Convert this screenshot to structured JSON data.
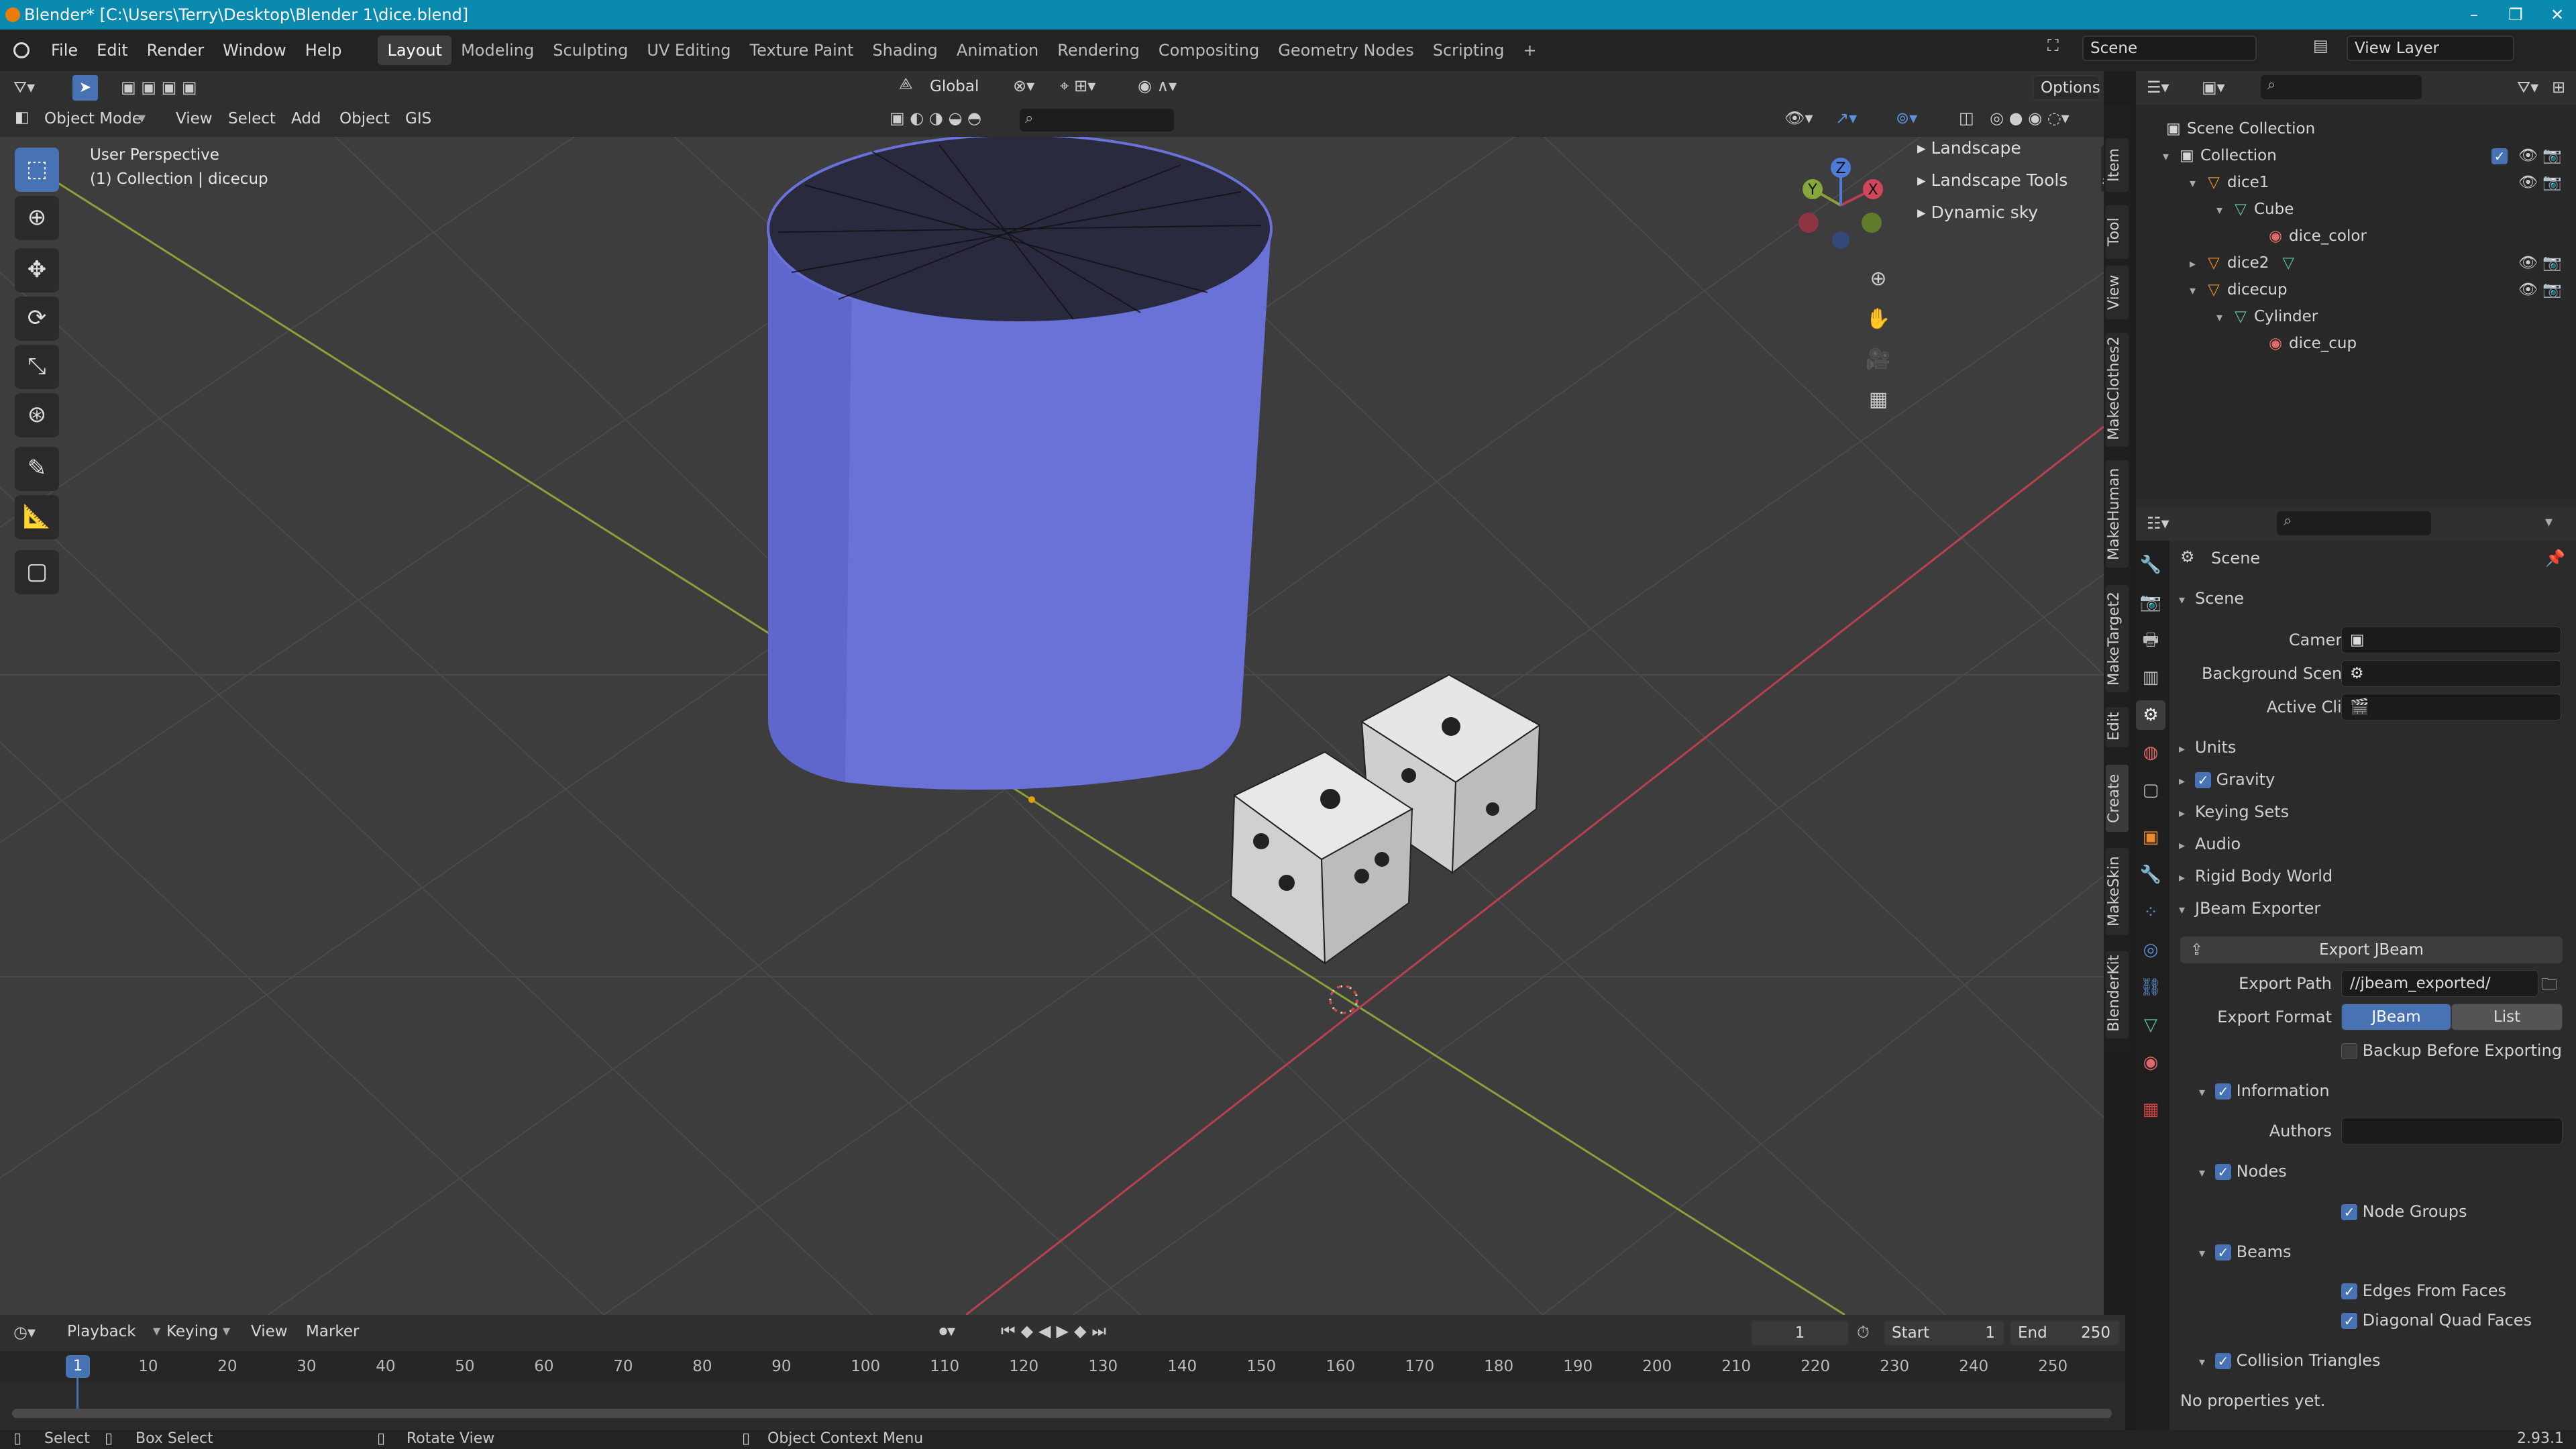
{
  "window": {
    "title": "Blender* [C:\\Users\\Terry\\Desktop\\Blender 1\\dice.blend]",
    "controls": [
      "–",
      "❐",
      "✕"
    ]
  },
  "menubar": {
    "menus": [
      "File",
      "Edit",
      "Render",
      "Window",
      "Help"
    ],
    "workspaces": [
      "Layout",
      "Modeling",
      "Sculpting",
      "UV Editing",
      "Texture Paint",
      "Shading",
      "Animation",
      "Rendering",
      "Compositing",
      "Geometry Nodes",
      "Scripting"
    ],
    "add_tab": "+",
    "scene": "Scene",
    "view_layer": "View Layer"
  },
  "viewport_header": {
    "transform_orientation": "Global",
    "options": "Options",
    "mode": "Object Mode",
    "menus": [
      "View",
      "Select",
      "Add",
      "Object",
      "GIS"
    ]
  },
  "viewport": {
    "perspective": "User Perspective",
    "collection": "(1) Collection | dicecup",
    "overlay_panels": [
      "Landscape",
      "Landscape Tools",
      "Dynamic sky"
    ],
    "side_tabs": [
      "Item",
      "Tool",
      "View",
      "MakeClothes2",
      "MakeHuman",
      "MakeTarget2",
      "Edit",
      "Create",
      "MakeSkin",
      "BlenderKit"
    ],
    "gizmo": {
      "x": "X",
      "y": "Y",
      "z": "Z"
    }
  },
  "outliner": {
    "items": [
      {
        "label": "Scene Collection",
        "depth": 0
      },
      {
        "label": "Collection",
        "depth": 1
      },
      {
        "label": "dice1",
        "depth": 2
      },
      {
        "label": "Cube",
        "depth": 3
      },
      {
        "label": "dice_color",
        "depth": 4
      },
      {
        "label": "dice2",
        "depth": 2
      },
      {
        "label": "dicecup",
        "depth": 2
      },
      {
        "label": "Cylinder",
        "depth": 3
      },
      {
        "label": "dice_cup",
        "depth": 4
      }
    ]
  },
  "properties": {
    "context": "Scene",
    "scene_panel": {
      "title": "Scene",
      "camera_label": "Camera",
      "background_label": "Background Scene",
      "active_clip_label": "Active Clip"
    },
    "collapsed_panels": [
      "Units",
      "Gravity",
      "Keying Sets",
      "Audio",
      "Rigid Body World"
    ],
    "jbeam": {
      "title": "JBeam Exporter",
      "export_button": "Export JBeam",
      "export_path_label": "Export Path",
      "export_path": "//jbeam_exported/",
      "export_format_label": "Export Format",
      "format_options": [
        "JBeam",
        "List"
      ],
      "selected_format": "JBeam",
      "backup_label": "Backup Before Exporting",
      "information": "Information",
      "authors_label": "Authors",
      "nodes": "Nodes",
      "node_groups": "Node Groups",
      "beams": "Beams",
      "edges_from_faces": "Edges From Faces",
      "diagonal_quad_faces": "Diagonal Quad Faces",
      "collision_triangles": "Collision Triangles",
      "no_props": "No properties yet."
    }
  },
  "timeline": {
    "menus": [
      "Playback",
      "Keying",
      "View",
      "Marker"
    ],
    "current_frame": "1",
    "start_label": "Start",
    "start": "1",
    "end_label": "End",
    "end": "250",
    "ticks": [
      "1",
      "10",
      "20",
      "30",
      "40",
      "50",
      "60",
      "70",
      "80",
      "90",
      "100",
      "110",
      "120",
      "130",
      "140",
      "150",
      "160",
      "170",
      "180",
      "190",
      "200",
      "210",
      "220",
      "230",
      "240",
      "250"
    ]
  },
  "statusbar": {
    "select": "Select",
    "box_select": "Box Select",
    "rotate_view": "Rotate View",
    "context_menu": "Object Context Menu",
    "version": "2.93.1"
  },
  "colors": {
    "accent": "#4772b3",
    "titlebar": "#0b8ab0",
    "viewport_bg": "#3d3d3d",
    "cup": "#6a72d8",
    "dice": "#d9d9d9",
    "x_axis": "#b84050",
    "y_axis": "#8aa03a"
  }
}
